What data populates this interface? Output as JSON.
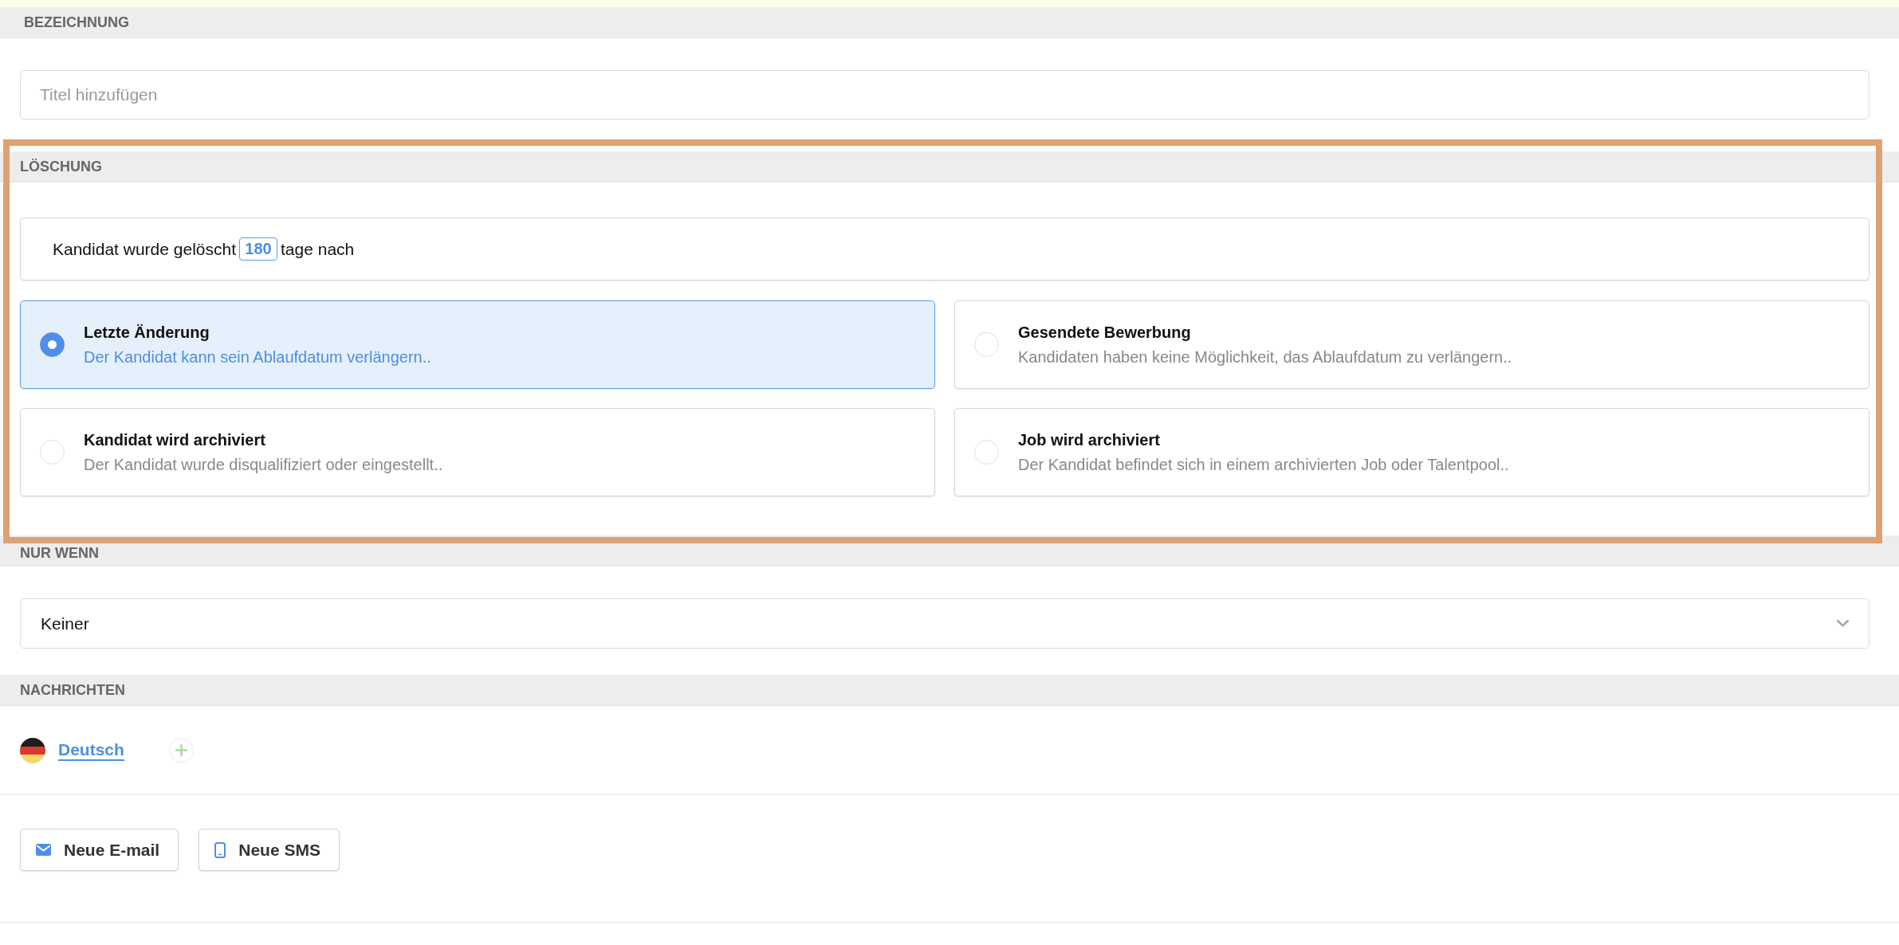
{
  "title_section": {
    "heading": "BEZEICHNUNG",
    "title_field": {
      "placeholder": "Titel hinzufügen"
    }
  },
  "deletion_section": {
    "heading": "LÖSCHUNG",
    "rule": {
      "text_before": "Kandidat wurde gelöscht",
      "days": "180",
      "text_after": "tage nach"
    },
    "options": [
      {
        "title": "Letzte Änderung",
        "description": "Der Kandidat kann sein Ablaufdatum verlängern..",
        "selected": true
      },
      {
        "title": "Gesendete Bewerbung",
        "description": "Kandidaten haben keine Möglichkeit, das Ablaufdatum zu verlängern..",
        "selected": false
      },
      {
        "title": "Kandidat wird archiviert",
        "description": "Der Kandidat wurde disqualifiziert oder eingestellt..",
        "selected": false
      },
      {
        "title": "Job wird archiviert",
        "description": "Der Kandidat befindet sich in einem archivierten Job oder Talentpool..",
        "selected": false
      }
    ]
  },
  "condition_section": {
    "heading": "NUR WENN",
    "select": {
      "value": "Keiner"
    }
  },
  "messages_section": {
    "heading": "NACHRICHTEN",
    "languages": [
      {
        "label": "Deutsch",
        "selected": true
      }
    ],
    "buttons": [
      {
        "kind": "email",
        "label": "Neue E-mail"
      },
      {
        "kind": "sms",
        "label": "Neue SMS"
      }
    ]
  }
}
